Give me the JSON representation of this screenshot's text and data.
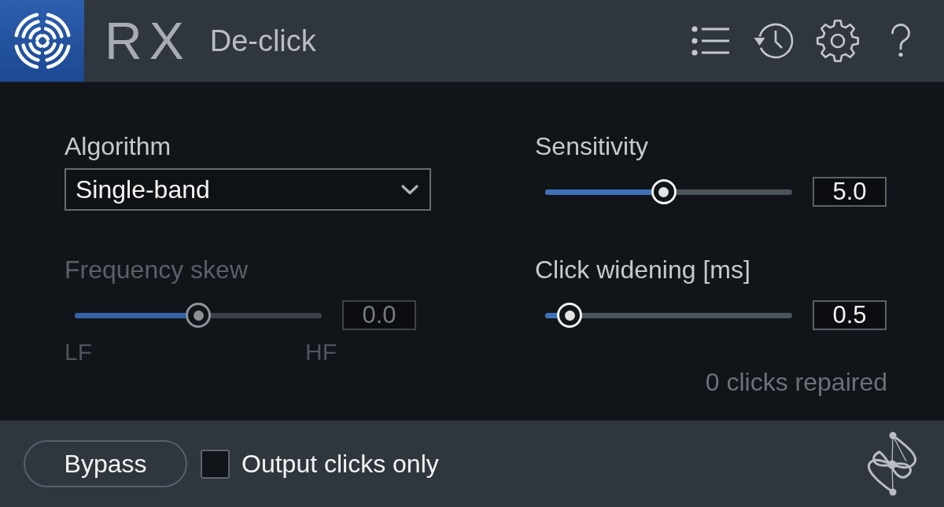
{
  "header": {
    "product": "RX",
    "title": "De-click"
  },
  "columns": [
    {
      "controls": [
        {
          "kind": "dropdown",
          "label": "Algorithm",
          "value": "Single-band",
          "disabled": false
        },
        {
          "kind": "slider",
          "label": "Frequency skew",
          "level": 0.5,
          "reading": "0.0",
          "min_label": "LF",
          "max_label": "HF",
          "disabled": true
        }
      ]
    },
    {
      "controls": [
        {
          "kind": "slider",
          "label": "Sensitivity",
          "level": 0.48,
          "reading": "5.0",
          "disabled": false
        },
        {
          "kind": "slider",
          "label": "Click widening [ms]",
          "level": 0.1,
          "reading": "0.5",
          "disabled": false
        }
      ],
      "status": "0 clicks repaired"
    }
  ],
  "footer": {
    "bypass_button": "Bypass",
    "checkbox": {
      "label": "Output clicks only",
      "checked": false
    }
  }
}
